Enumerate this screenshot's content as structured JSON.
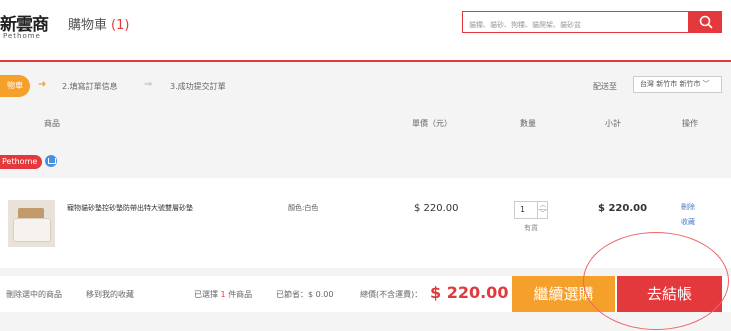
{
  "header": {
    "logo_main": "新雲商",
    "logo_sub": "Pethome",
    "cart_title": "購物車",
    "cart_count": "(1)",
    "search_placeholder": "貓糧、貓砂、狗糧、貓爬架、貓砂盆"
  },
  "steps": {
    "step1": "物車",
    "step2": "2.填寫訂單信息",
    "step3": "3.成功提交訂單",
    "deliver_label": "配送至",
    "deliver_value": "台灣 新竹市 新竹市"
  },
  "columns": {
    "product": "商品",
    "unit_price": "單價（元）",
    "quantity": "數量",
    "subtotal": "小計",
    "action": "操作"
  },
  "shop": {
    "name": "Pethome"
  },
  "item": {
    "name": "寵物貓砂墊控砂墊防帶出特大號雙層砂墊",
    "color": "顏色:白色",
    "price": "$ 220.00",
    "quantity": "1",
    "stock": "有貨",
    "subtotal": "$ 220.00",
    "delete": "刪除",
    "favorite": "收藏"
  },
  "footer": {
    "delete_selected": "刪除選中的商品",
    "move_to_favorites": "移到我的收藏",
    "selected_prefix": "已選擇",
    "selected_count": "1",
    "selected_suffix": "件商品",
    "saved_label": "已節省：",
    "saved_value": "$ 0.00",
    "total_label": "總價(不含運費)：",
    "total_value": "$ 220.00",
    "continue_button": "繼續選購",
    "checkout_button": "去結帳"
  },
  "colors": {
    "accent_red": "#e4393c",
    "accent_orange": "#f6a02c",
    "link_blue": "#4a7ec8"
  }
}
